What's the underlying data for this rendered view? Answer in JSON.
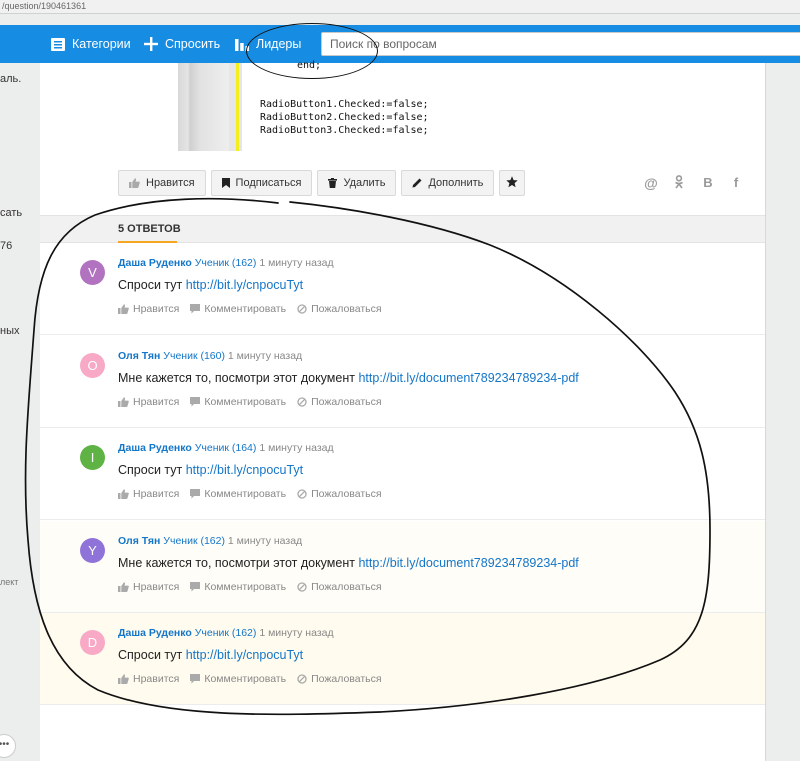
{
  "browser": {
    "url": "/question/190461361"
  },
  "header": {
    "nav": [
      {
        "label": "Категории",
        "icon": "list-icon"
      },
      {
        "label": "Спросить",
        "icon": "plus-icon"
      },
      {
        "label": "Лидеры",
        "icon": "bar-chart-icon"
      }
    ],
    "search_placeholder": "Поиск по вопросам",
    "brand_color": "#168de2"
  },
  "left_fragments": [
    "аль.",
    "сать",
    "76",
    "ных",
    "лект"
  ],
  "more_label": "•••",
  "code": {
    "lines": [
      "end;",
      "RadioButton1.Checked:=false;",
      "RadioButton2.Checked:=false;",
      "RadioButton3.Checked:=false;"
    ]
  },
  "question_actions": {
    "like": "Нравится",
    "subscribe": "Подписаться",
    "delete": "Удалить",
    "extend": "Дополнить"
  },
  "share_icons": [
    "@",
    "ok",
    "B",
    "f"
  ],
  "answers_title": "5 ОТВЕТОВ",
  "answer_actions": {
    "like": "Нравится",
    "comment": "Комментировать",
    "report": "Пожаловаться"
  },
  "answers": [
    {
      "letter": "V",
      "color": "#b173c0",
      "author": "Даша Руденко",
      "rank": "Ученик (162)",
      "time": "1 минуту назад",
      "text": "Спроси тут",
      "link": "http://bit.ly/cnpocuTyt"
    },
    {
      "letter": "O",
      "color": "#f7a9c6",
      "author": "Оля Тян",
      "rank": "Ученик (160)",
      "time": "1 минуту назад",
      "text": "Мне кажется то, посмотри этот документ",
      "link": "http://bit.ly/document789234789234-pdf"
    },
    {
      "letter": "I",
      "color": "#5fb344",
      "author": "Даша Руденко",
      "rank": "Ученик (164)",
      "time": "1 минуту назад",
      "text": "Спроси тут",
      "link": "http://bit.ly/cnpocuTyt"
    },
    {
      "letter": "Y",
      "color": "#8f73d8",
      "author": "Оля Тян",
      "rank": "Ученик (162)",
      "time": "1 минуту назад",
      "text": "Мне кажется то, посмотри этот документ",
      "link": "http://bit.ly/document789234789234-pdf"
    },
    {
      "letter": "D",
      "color": "#f7a9c6",
      "author": "Даша Руденко",
      "rank": "Ученик (162)",
      "time": "1 минуту назад",
      "text": "Спроси тут",
      "link": "http://bit.ly/cnpocuTyt"
    }
  ]
}
